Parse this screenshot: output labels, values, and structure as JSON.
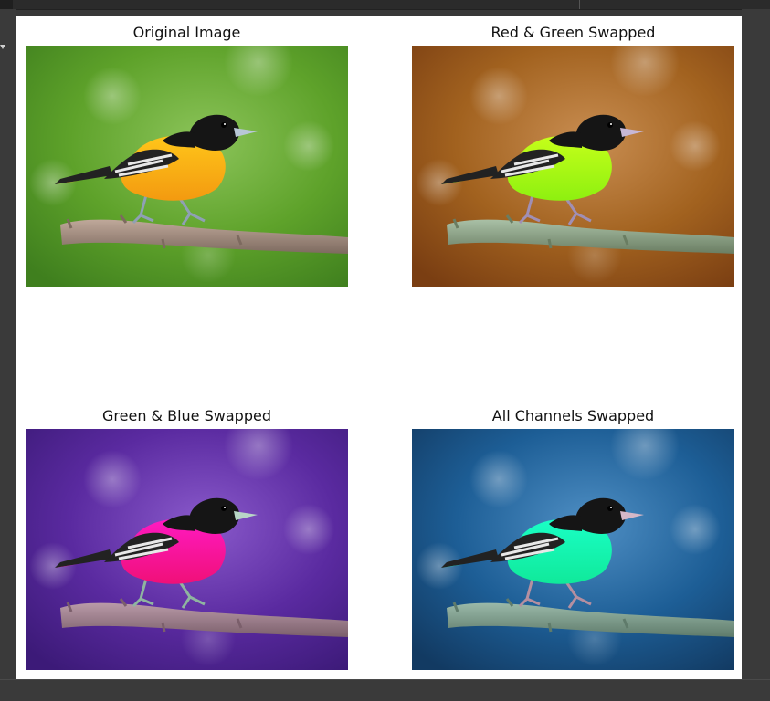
{
  "figure": {
    "panels": [
      {
        "title": "Original Image",
        "colors": {
          "bg_dark": "#3f7f1e",
          "bg_mid": "#5ea22a",
          "bg_light": "#8cc45a",
          "body": "#f39a10",
          "body_hi": "#ffc61a",
          "head": "#151515",
          "wing": "#222222",
          "wing_stripe": "#e8e8e8",
          "branch": "#bfa89a",
          "branch_dark": "#7d6a5f",
          "beak": "#b8c7d6",
          "legs": "#8fa0b5"
        }
      },
      {
        "title": "Red & Green Swapped",
        "colors": {
          "bg_dark": "#7a3e12",
          "bg_mid": "#a2621f",
          "bg_light": "#c98e52",
          "body": "#8ef010",
          "body_hi": "#c6ff1a",
          "head": "#151515",
          "wing": "#222222",
          "wing_stripe": "#e8e8e8",
          "branch": "#a9c0a6",
          "branch_dark": "#6a7d62",
          "beak": "#c7b8d6",
          "legs": "#a08fb5"
        }
      },
      {
        "title": "Green & Blue Swapped",
        "colors": {
          "bg_dark": "#3c1a78",
          "bg_mid": "#5a2aa0",
          "bg_light": "#8a5acb",
          "body": "#f01078",
          "body_hi": "#ff1ac2",
          "head": "#151515",
          "wing": "#222222",
          "wing_stripe": "#e8e8e8",
          "branch": "#b99aa8",
          "branch_dark": "#7b5f6b",
          "beak": "#b8d6c7",
          "legs": "#8fb5a0"
        }
      },
      {
        "title": "All Channels Swapped",
        "colors": {
          "bg_dark": "#123a62",
          "bg_mid": "#1d5e96",
          "bg_light": "#4f8fc4",
          "body": "#10e99a",
          "body_hi": "#1affc6",
          "head": "#151515",
          "wing": "#222222",
          "wing_stripe": "#e8e8e8",
          "branch": "#9ab9a9",
          "branch_dark": "#5f7b6b",
          "beak": "#d6b8c7",
          "legs": "#b58fa0"
        }
      }
    ]
  }
}
